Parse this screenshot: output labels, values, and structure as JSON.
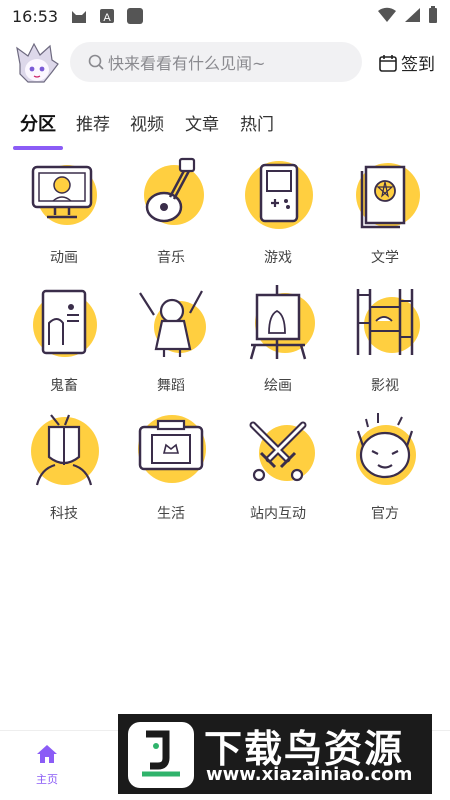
{
  "status": {
    "time": "16:53"
  },
  "header": {
    "search_placeholder": "快来看看有什么见闻~",
    "signin_label": "签到"
  },
  "tabs": [
    {
      "label": "分区",
      "active": true
    },
    {
      "label": "推荐"
    },
    {
      "label": "视频"
    },
    {
      "label": "文章"
    },
    {
      "label": "热门"
    }
  ],
  "categories": [
    {
      "label": "动画",
      "icon": "tv-icon"
    },
    {
      "label": "音乐",
      "icon": "guitar-icon"
    },
    {
      "label": "游戏",
      "icon": "gameboy-icon"
    },
    {
      "label": "文学",
      "icon": "book-icon"
    },
    {
      "label": "鬼畜",
      "icon": "poster-icon"
    },
    {
      "label": "舞蹈",
      "icon": "dancer-icon"
    },
    {
      "label": "绘画",
      "icon": "easel-icon"
    },
    {
      "label": "影视",
      "icon": "film-icon"
    },
    {
      "label": "科技",
      "icon": "cyborg-icon"
    },
    {
      "label": "生活",
      "icon": "camera-icon"
    },
    {
      "label": "站内互动",
      "icon": "swords-icon"
    },
    {
      "label": "官方",
      "icon": "mascot-icon"
    }
  ],
  "bottom_nav": {
    "home_label": "主页"
  },
  "watermark": {
    "title": "下载鸟资源",
    "url": "www.xiazainiao.com"
  },
  "colors": {
    "accent": "#8b5cf6",
    "icon_fill": "#ffcf40",
    "icon_stroke": "#3a2d4a"
  }
}
